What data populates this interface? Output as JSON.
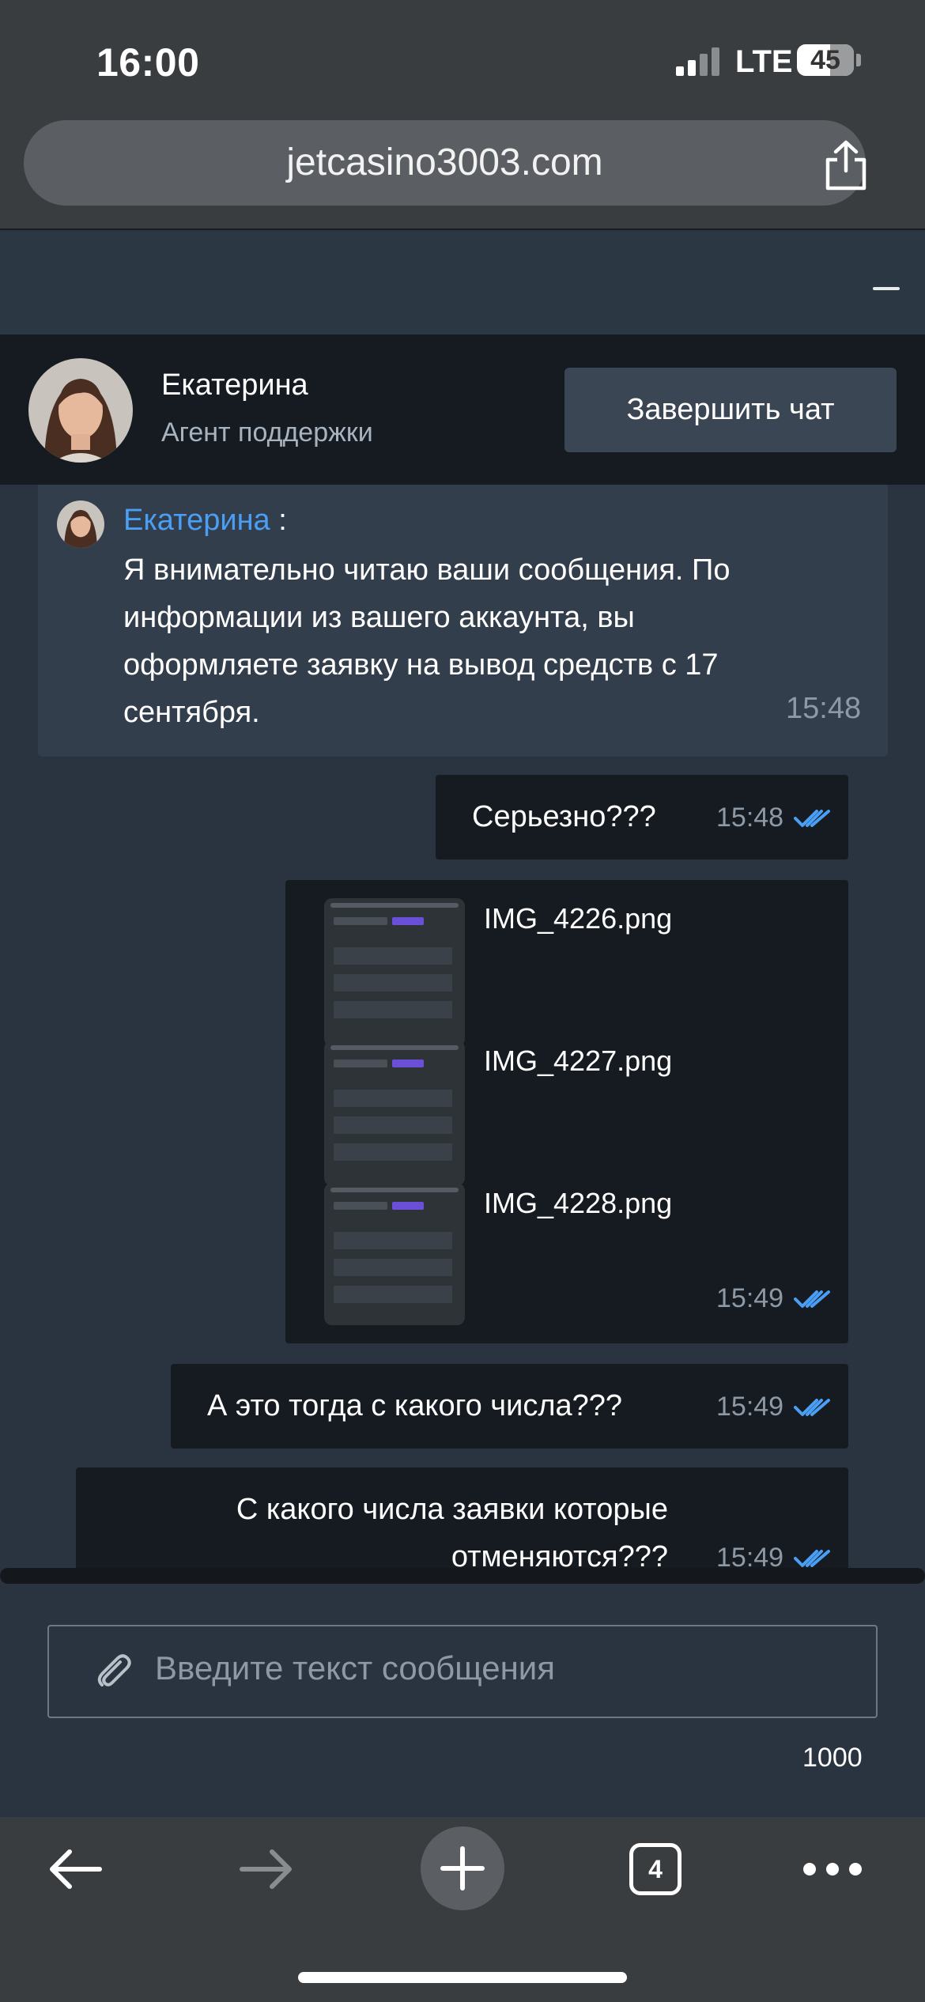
{
  "status_bar": {
    "time": "16:00",
    "network": "LTE",
    "battery": "45"
  },
  "browser": {
    "url": "jetcasino3003.com",
    "tabs_count": "4"
  },
  "chat_header": {
    "agent_name": "Екатерина",
    "agent_role": "Агент поддержки",
    "end_chat_label": "Завершить чат"
  },
  "messages": [
    {
      "direction": "incoming",
      "sender": "Екатерина",
      "colon": ":",
      "text": "Я внимательно читаю ваши сообщения. По информации из вашего аккаунта, вы оформляете заявку на вывод средств с 17 сентября.",
      "time": "15:48"
    },
    {
      "direction": "outgoing",
      "text": "Серьезно???",
      "time": "15:48",
      "read": true
    },
    {
      "direction": "outgoing",
      "attachments": [
        "IMG_4226.png",
        "IMG_4227.png",
        "IMG_4228.png"
      ],
      "time": "15:49",
      "read": true
    },
    {
      "direction": "outgoing",
      "text": "А это тогда с какого числа???",
      "time": "15:49",
      "read": true
    },
    {
      "direction": "outgoing",
      "text_line1": "С какого числа заявки которые",
      "text_line2": "отменяются???",
      "time": "15:49",
      "read": true
    }
  ],
  "composer": {
    "placeholder": "Введите текст сообщения",
    "char_limit": "1000"
  },
  "colors": {
    "accent_blue": "#4a9ff5",
    "bg": "#2a3441",
    "header": "#161b21",
    "outgoing_bubble": "#161b22",
    "incoming_bubble": "#333e4c"
  }
}
